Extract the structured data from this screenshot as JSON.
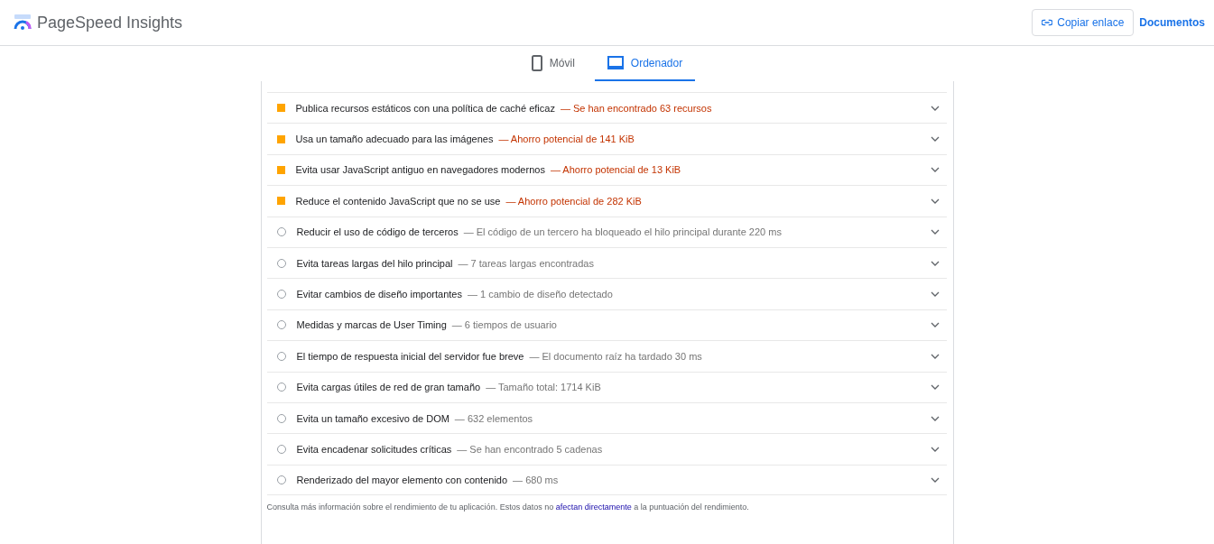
{
  "header": {
    "title": "PageSpeed Insights",
    "copy_button": "Copiar enlace",
    "docs_link": "Documentos"
  },
  "tabs": [
    {
      "label": "Móvil",
      "kind": "mobile",
      "selected": false
    },
    {
      "label": "Ordenador",
      "kind": "desktop",
      "selected": true
    }
  ],
  "audits": [
    {
      "kind": "warning",
      "title": "Publica recursos estáticos con una política de caché eficaz",
      "detail": "— Se han encontrado 63 recursos"
    },
    {
      "kind": "warning",
      "title": "Usa un tamaño adecuado para las imágenes",
      "detail": "— Ahorro potencial de 141 KiB"
    },
    {
      "kind": "warning",
      "title": "Evita usar JavaScript antiguo en navegadores modernos",
      "detail": "— Ahorro potencial de 13 KiB"
    },
    {
      "kind": "warning",
      "title": "Reduce el contenido JavaScript que no se use",
      "detail": "— Ahorro potencial de 282 KiB"
    },
    {
      "kind": "info",
      "title": "Reducir el uso de código de terceros",
      "detail": "— El código de un tercero ha bloqueado el hilo principal durante 220 ms"
    },
    {
      "kind": "info",
      "title": "Evita tareas largas del hilo principal",
      "detail": "— 7 tareas largas encontradas"
    },
    {
      "kind": "info",
      "title": "Evitar cambios de diseño importantes",
      "detail": "— 1 cambio de diseño detectado"
    },
    {
      "kind": "info",
      "title": "Medidas y marcas de User Timing",
      "detail": "— 6 tiempos de usuario"
    },
    {
      "kind": "info",
      "title": "El tiempo de respuesta inicial del servidor fue breve",
      "detail": "— El documento raíz ha tardado 30 ms"
    },
    {
      "kind": "info",
      "title": "Evita cargas útiles de red de gran tamaño",
      "detail": "— Tamaño total: 1714 KiB"
    },
    {
      "kind": "info",
      "title": "Evita un tamaño excesivo de DOM",
      "detail": "— 632 elementos"
    },
    {
      "kind": "info",
      "title": "Evita encadenar solicitudes críticas",
      "detail": "— Se han encontrado 5 cadenas"
    },
    {
      "kind": "info",
      "title": "Renderizado del mayor elemento con contenido",
      "detail": "— 680 ms"
    }
  ],
  "footer": {
    "text_before": "Consulta más información sobre el rendimiento de tu aplicación. Estos datos no",
    "link": "afectan directamente",
    "text_after": "a la puntuación del rendimiento."
  }
}
